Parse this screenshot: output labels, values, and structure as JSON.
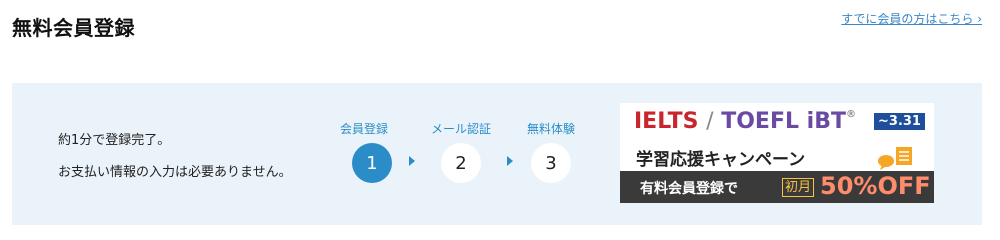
{
  "header": {
    "title": "無料会員登録",
    "login_link": "すでに会員の方はこちら ›"
  },
  "intro": {
    "line1": "約1分で登録完了。",
    "line2": "お支払い情報の入力は必要ありません。"
  },
  "steps": [
    {
      "label": "会員登録",
      "number": "1",
      "state": "active"
    },
    {
      "label": "メール認証",
      "number": "2",
      "state": "inactive"
    },
    {
      "label": "無料体験",
      "number": "3",
      "state": "inactive"
    }
  ],
  "banner": {
    "ielts": "IELTS",
    "slash": "/",
    "toefl": "TOEFL iBT",
    "sup": "®",
    "date": "~3.31",
    "campaign": "学習応援キャンペーン",
    "free_text": "有料会員登録で",
    "month_text": "初月",
    "off_text": "50%OFF",
    "icon": "book-chat-icon"
  },
  "colors": {
    "accent": "#2b8dc8",
    "panel_bg": "#eaf3f9",
    "link": "#3a86c8"
  }
}
